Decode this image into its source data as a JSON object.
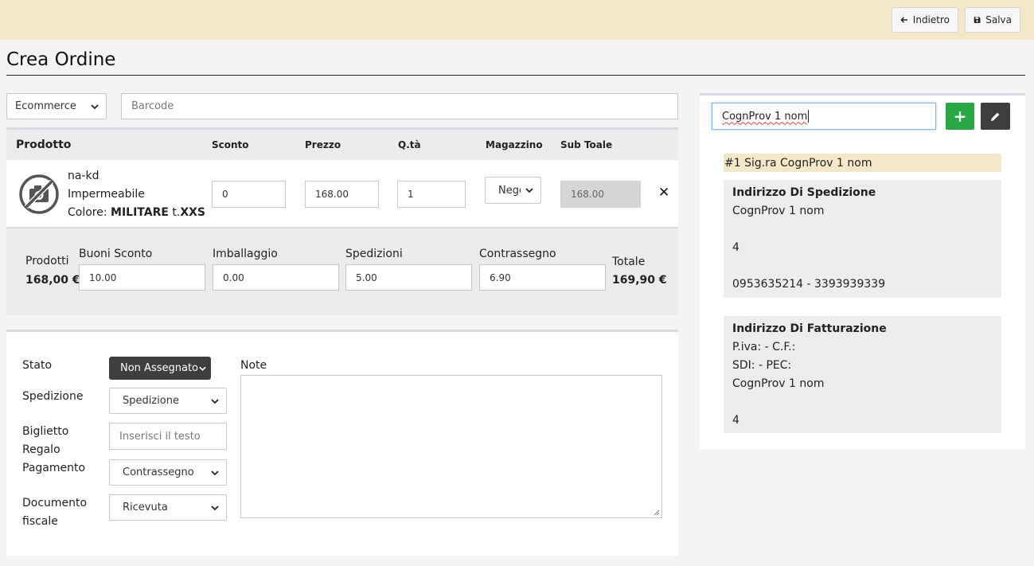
{
  "toolbar": {
    "back_label": "Indietro",
    "save_label": "Salva"
  },
  "page": {
    "title": "Crea Ordine"
  },
  "filters": {
    "channel_value": "Ecommerce",
    "barcode_placeholder": "Barcode"
  },
  "table": {
    "headers": {
      "product": "Prodotto",
      "discount": "Sconto",
      "price": "Prezzo",
      "qty": "Q.tà",
      "warehouse": "Magazzino",
      "subtotal": "Sub Toale"
    },
    "row": {
      "brand": "na-kd",
      "name": "Impermeabile",
      "color_prefix": "Colore: ",
      "color_value": "MILITARE",
      "size_prefix": " t.",
      "size_value": "XXS",
      "discount": "0",
      "price": "168.00",
      "qty": "1",
      "warehouse": "Negozio",
      "subtotal": "168.00",
      "remove_glyph": "✕"
    }
  },
  "summary": {
    "products_label": "Prodotti",
    "products_value": "168,00 €",
    "vouchers_label": "Buoni Sconto",
    "vouchers_value": "10.00",
    "packaging_label": "Imballaggio",
    "packaging_value": "0.00",
    "shipping_label": "Spedizioni",
    "shipping_value": "5.00",
    "cod_label": "Contrassegno",
    "cod_value": "6.90",
    "total_label": "Totale",
    "total_value": "169,90 €"
  },
  "order_form": {
    "status_label": "Stato",
    "status_value": "Non Assegnato",
    "shipping_label": "Spedizione",
    "shipping_value": "Spedizione",
    "gift_label_1": "Biglietto",
    "gift_label_2": "Regalo",
    "gift_placeholder": "Inserisci il testo",
    "payment_label": "Pagamento",
    "payment_value": "Contrassegno",
    "fiscal_label_1": "Documento",
    "fiscal_label_2": "fiscale",
    "fiscal_value": "Ricevuta",
    "notes_label": "Note"
  },
  "customer": {
    "search_value": "CognProv 1 nom",
    "add_glyph": "+",
    "header": "#1 Sig.ra CognProv 1 nom",
    "shipping": {
      "title": "Indirizzo Di Spedizione",
      "name": "CognProv 1 nom",
      "number": "4",
      "phones": "0953635214 - 3393939339"
    },
    "billing": {
      "title": "Indirizzo Di Fatturazione",
      "vat_line": "P.iva: - C.F.:",
      "sdi_line": "SDI: - PEC:",
      "name": "CognProv 1 nom",
      "number": "4"
    }
  }
}
